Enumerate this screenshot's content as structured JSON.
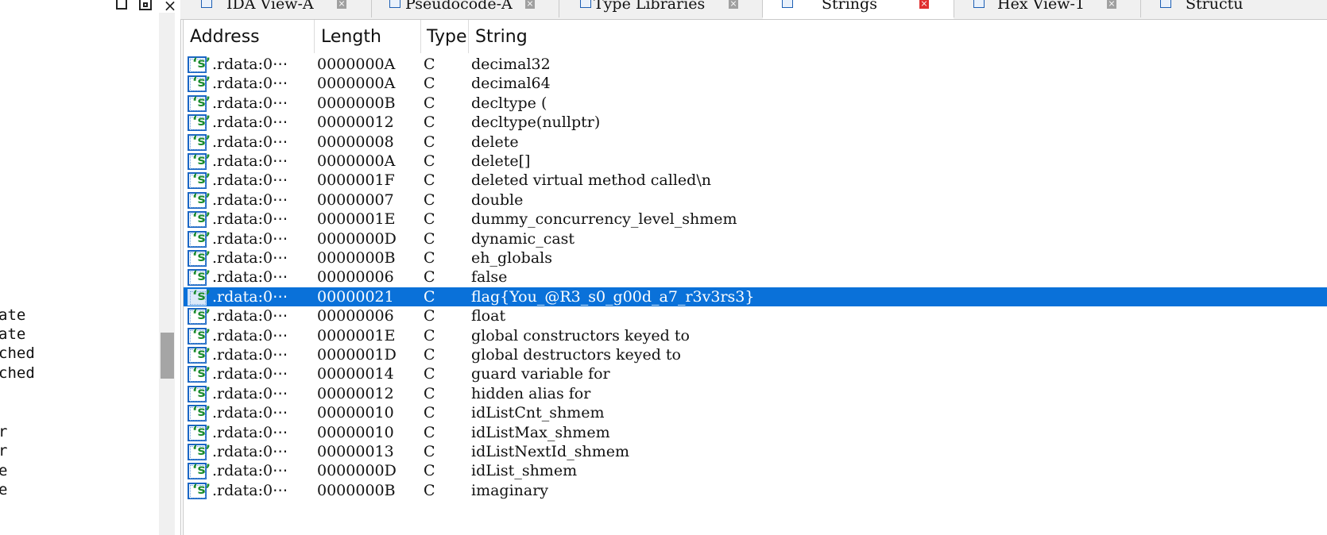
{
  "left_panel": {
    "fragments": [
      "ate",
      "ate",
      "ched",
      "ched",
      "r",
      "r",
      "e",
      "e"
    ]
  },
  "tabs": [
    {
      "label": "IDA View-A",
      "icon": "disassembly-icon"
    },
    {
      "label": "Pseudocode-A",
      "icon": "pseudocode-icon"
    },
    {
      "label": "Type Libraries",
      "icon": "type-library-icon"
    },
    {
      "label": "Strings",
      "icon": "strings-icon",
      "active": true
    },
    {
      "label": "Hex View-1",
      "icon": "hex-icon"
    },
    {
      "label": "Structu",
      "icon": "structures-icon"
    }
  ],
  "table": {
    "columns": [
      "Address",
      "Length",
      "Type",
      "String"
    ],
    "selected_index": 12,
    "rows": [
      {
        "address": ".rdata:0⋯",
        "length": "0000000A",
        "type": "C",
        "string": "decimal32"
      },
      {
        "address": ".rdata:0⋯",
        "length": "0000000A",
        "type": "C",
        "string": "decimal64"
      },
      {
        "address": ".rdata:0⋯",
        "length": "0000000B",
        "type": "C",
        "string": "decltype ("
      },
      {
        "address": ".rdata:0⋯",
        "length": "00000012",
        "type": "C",
        "string": "decltype(nullptr)"
      },
      {
        "address": ".rdata:0⋯",
        "length": "00000008",
        "type": "C",
        "string": "delete"
      },
      {
        "address": ".rdata:0⋯",
        "length": "0000000A",
        "type": "C",
        "string": "delete[]"
      },
      {
        "address": ".rdata:0⋯",
        "length": "0000001F",
        "type": "C",
        "string": "deleted virtual method called\\n"
      },
      {
        "address": ".rdata:0⋯",
        "length": "00000007",
        "type": "C",
        "string": "double"
      },
      {
        "address": ".rdata:0⋯",
        "length": "0000001E",
        "type": "C",
        "string": "dummy_concurrency_level_shmem"
      },
      {
        "address": ".rdata:0⋯",
        "length": "0000000D",
        "type": "C",
        "string": "dynamic_cast"
      },
      {
        "address": ".rdata:0⋯",
        "length": "0000000B",
        "type": "C",
        "string": "eh_globals"
      },
      {
        "address": ".rdata:0⋯",
        "length": "00000006",
        "type": "C",
        "string": "false"
      },
      {
        "address": ".rdata:0⋯",
        "length": "00000021",
        "type": "C",
        "string": "flag{You_@R3_s0_g00d_a7_r3v3rs3}"
      },
      {
        "address": ".rdata:0⋯",
        "length": "00000006",
        "type": "C",
        "string": "float"
      },
      {
        "address": ".rdata:0⋯",
        "length": "0000001E",
        "type": "C",
        "string": "global constructors keyed to"
      },
      {
        "address": ".rdata:0⋯",
        "length": "0000001D",
        "type": "C",
        "string": "global destructors keyed to"
      },
      {
        "address": ".rdata:0⋯",
        "length": "00000014",
        "type": "C",
        "string": "guard variable for"
      },
      {
        "address": ".rdata:0⋯",
        "length": "00000012",
        "type": "C",
        "string": "hidden alias for"
      },
      {
        "address": ".rdata:0⋯",
        "length": "00000010",
        "type": "C",
        "string": "idListCnt_shmem"
      },
      {
        "address": ".rdata:0⋯",
        "length": "00000010",
        "type": "C",
        "string": "idListMax_shmem"
      },
      {
        "address": ".rdata:0⋯",
        "length": "00000013",
        "type": "C",
        "string": "idListNextId_shmem"
      },
      {
        "address": ".rdata:0⋯",
        "length": "0000000D",
        "type": "C",
        "string": "idList_shmem"
      },
      {
        "address": ".rdata:0⋯",
        "length": "0000000B",
        "type": "C",
        "string": "imaginary"
      }
    ]
  },
  "colors": {
    "selection": "#0a71d9",
    "string_icon_border": "#1a66c4",
    "string_icon_glyph": "#1c8c2f",
    "active_close": "#e03030"
  }
}
